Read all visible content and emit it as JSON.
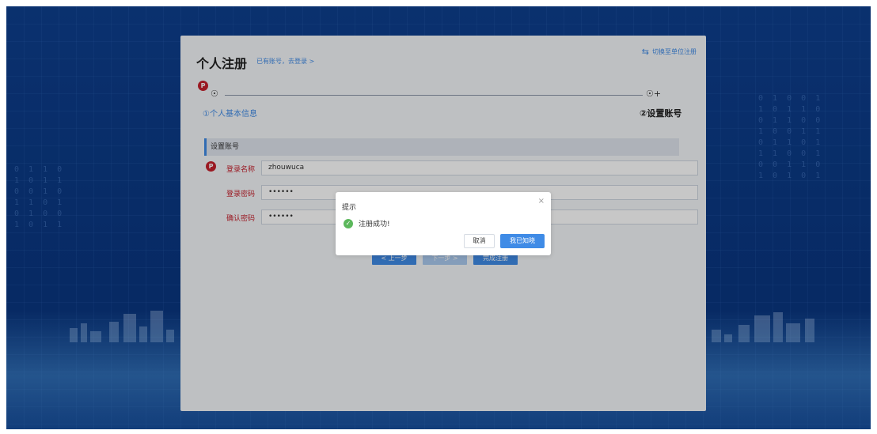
{
  "page": {
    "title": "个人注册",
    "login_link": "已有账号，去登录 >",
    "switch_label": "切换至单位注册",
    "icons": {
      "switch": "swap-icon",
      "step1": "user-icon",
      "step2": "user-plus-icon",
      "badge": "badge-icon"
    },
    "badge_letter": "P"
  },
  "steps": [
    {
      "label": "①个人基本信息"
    },
    {
      "label": "②设置账号"
    }
  ],
  "section": {
    "title": "设置账号"
  },
  "form": {
    "username_label": "登录名称",
    "username_value": "zhouwuca",
    "password_label": "登录密码",
    "password_value": "••••••",
    "confirm_label": "确认密码",
    "confirm_value": "••••••"
  },
  "buttons": {
    "prev": "< 上一步",
    "next": "下一步 >",
    "finish": "完成注册"
  },
  "dialog": {
    "title": "提示",
    "close": "×",
    "message": "注册成功!",
    "cancel": "取消",
    "confirm": "我已知晓"
  },
  "colors": {
    "accent": "#3f8be6",
    "required": "#c6202c",
    "success": "#5cb85c",
    "bg_dark": "#0b3a86"
  }
}
